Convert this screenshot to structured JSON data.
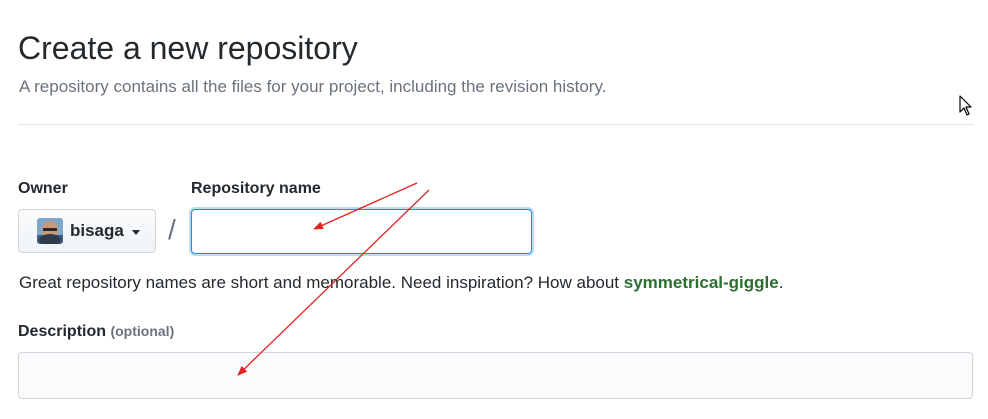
{
  "page": {
    "title": "Create a new repository",
    "subtitle": "A repository contains all the files for your project, including the revision history."
  },
  "owner": {
    "label": "Owner",
    "name": "bisaga",
    "avatar_icon": "user-avatar"
  },
  "separator": "/",
  "repository_name": {
    "label": "Repository name",
    "value": "",
    "placeholder": ""
  },
  "hint": {
    "text": "Great repository names are short and memorable. Need inspiration? How about ",
    "suggestion": "symmetrical-giggle",
    "end": "."
  },
  "description": {
    "label": "Description",
    "optional": "(optional)",
    "value": "",
    "placeholder": ""
  },
  "annotations": {
    "arrow_color": "#e32222"
  },
  "colors": {
    "suggestion": "#2c6e2f",
    "focus_border": "#2188ff"
  }
}
